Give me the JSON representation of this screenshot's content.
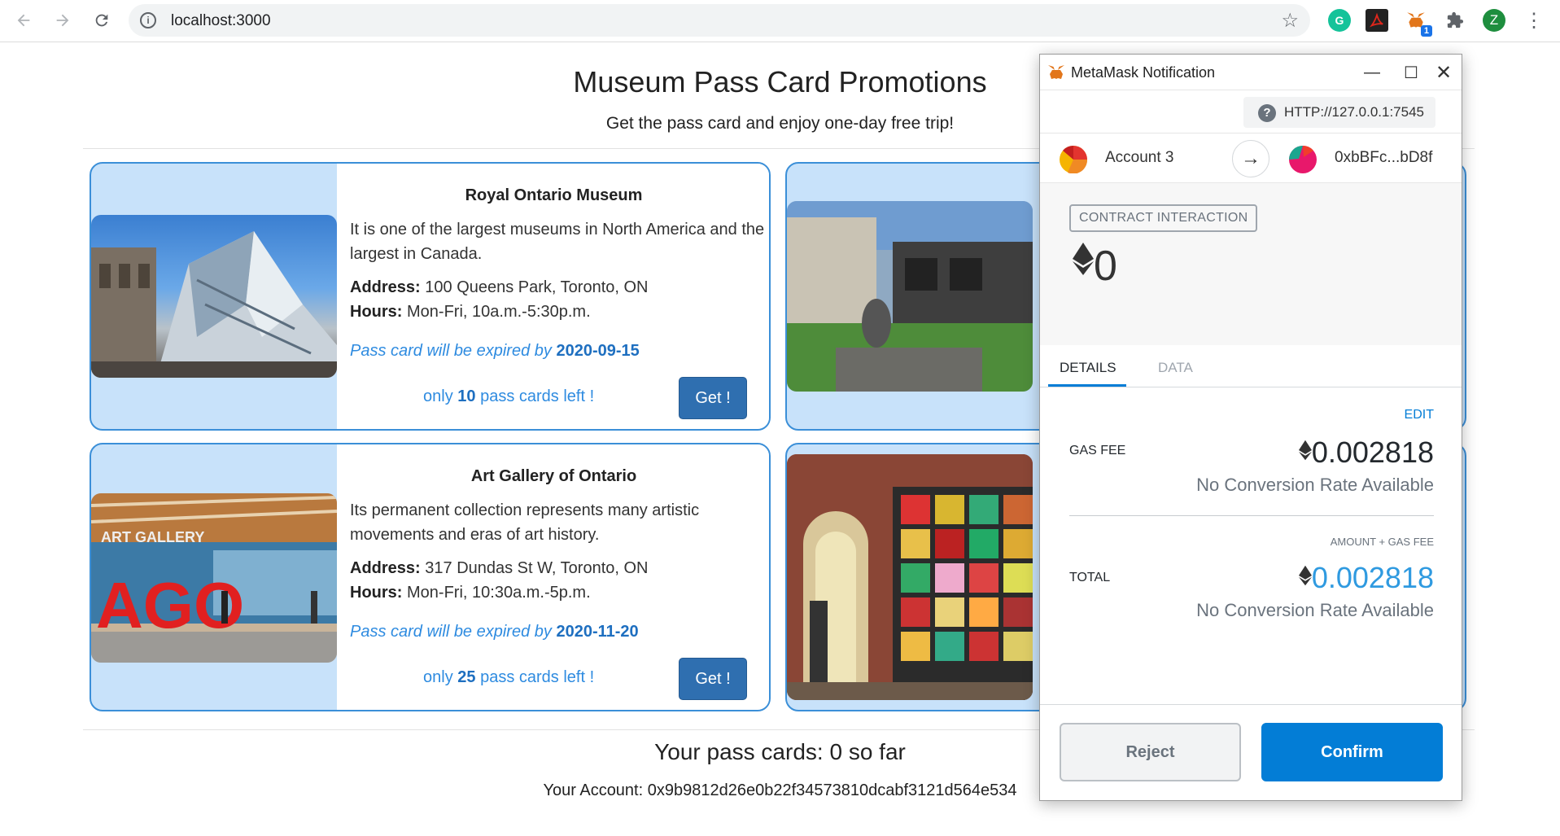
{
  "browser": {
    "url": "localhost:3000"
  },
  "page": {
    "title": "Museum Pass Card Promotions",
    "subtitle": "Get the pass card and enjoy one-day free trip!",
    "cards": [
      {
        "name": "Royal Ontario Museum",
        "description": "It is one of the largest museums in North America and the largest in Canada.",
        "address_label": "Address:",
        "address": "100 Queens Park, Toronto, ON",
        "hours_label": "Hours:",
        "hours": "Mon-Fri, 10a.m.-5:30p.m.",
        "expire_prefix": "Pass card will be expired by",
        "expire_date": "2020-09-15",
        "left_prefix": "only",
        "left_count": "10",
        "left_suffix": "pass cards left !",
        "button": "Get !"
      },
      {
        "name": "Art Gallery of Ontario",
        "description": "Its permanent collection represents many artistic movements and eras of art history.",
        "address_label": "Address:",
        "address": "317 Dundas St W, Toronto, ON",
        "hours_label": "Hours:",
        "hours": "Mon-Fri, 10:30a.m.-5p.m.",
        "expire_prefix": "Pass card will be expired by",
        "expire_date": "2020-11-20",
        "left_prefix": "only",
        "left_count": "25",
        "left_suffix": "pass cards left !",
        "button": "Get !"
      }
    ],
    "pass_count_text": "Your pass cards: 0 so far",
    "account_text": "Your Account: 0x9b9812d26e0b22f34573810dcabf3121d564e534"
  },
  "metamask": {
    "window_title": "MetaMask Notification",
    "origin": "HTTP://127.0.0.1:7545",
    "from_account": "Account 3",
    "to_address": "0xbBFc...bD8f",
    "tag": "CONTRACT INTERACTION",
    "eth_value": "0",
    "tabs": [
      "DETAILS",
      "DATA"
    ],
    "edit": "EDIT",
    "gas_fee_label": "GAS FEE",
    "gas_fee_amount": "0.002818",
    "no_conversion": "No Conversion Rate Available",
    "total_sub_label": "AMOUNT + GAS FEE",
    "total_label": "TOTAL",
    "total_amount": "0.002818",
    "reject": "Reject",
    "confirm": "Confirm"
  },
  "colors": {
    "accent_blue": "#037dd6",
    "card_border": "#3b8fd8",
    "card_background": "#c8e2fa",
    "link_blue": "#2e8be0"
  },
  "icons": {
    "back": "arrow-left-icon",
    "forward": "arrow-right-icon",
    "reload": "reload-icon",
    "info": "info-icon",
    "bookmark": "star-icon",
    "extensions": [
      "grammarly-icon",
      "acrobat-icon",
      "metamask-fox-icon",
      "puzzle-icon"
    ],
    "profile_initial": "Z",
    "menu": "kebab-menu-icon"
  }
}
